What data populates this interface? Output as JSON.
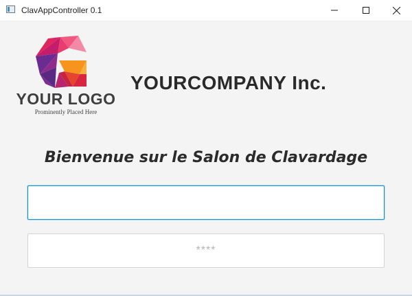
{
  "window": {
    "title": "ClavAppController 0.1",
    "controls": {
      "minimize_icon": "minimize-icon",
      "maximize_icon": "maximize-icon",
      "close_icon": "close-icon"
    }
  },
  "logo": {
    "text": "YOUR LOGO",
    "tagline": "Prominently Placed Here",
    "colors": {
      "magenta": "#e0245e",
      "purple": "#6a2c91",
      "pink": "#f2577f",
      "orange": "#f7941d",
      "red": "#e5452f"
    }
  },
  "company": {
    "name": "YOURCOMPANY Inc."
  },
  "welcome": {
    "text": "Bienvenue sur le Salon de Clavardage"
  },
  "form": {
    "username": {
      "value": "",
      "placeholder": ""
    },
    "password": {
      "value": "",
      "placeholder": "****"
    }
  },
  "colors": {
    "background": "#f4f4f4",
    "focus_border": "#0f97d8"
  }
}
